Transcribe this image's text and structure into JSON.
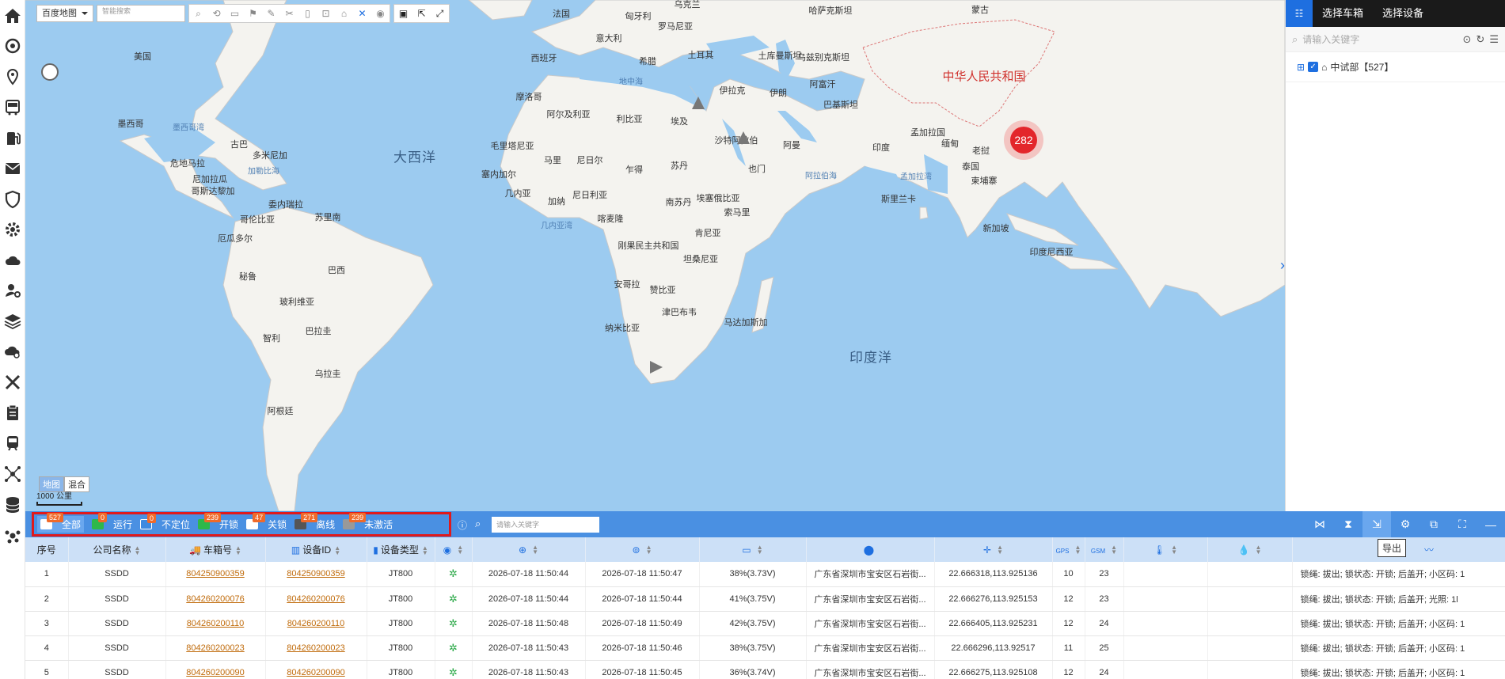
{
  "map_toolbar": {
    "map_type_select": "百度地图",
    "search_placeholder": "智能搜索",
    "icons": [
      "search-area-icon",
      "route-icon",
      "rectangle-icon",
      "flag-icon",
      "brush-icon",
      "clear-icon",
      "ruler-icon",
      "camera-icon",
      "chart-icon",
      "crosshair-icon",
      "location-icon",
      "save-icon",
      "export-icon",
      "fullscreen-icon"
    ]
  },
  "map": {
    "labels": [
      {
        "text": "法国",
        "cls": ""
      },
      {
        "text": "乌克兰",
        "cls": ""
      },
      {
        "text": "哈萨克斯坦",
        "cls": ""
      },
      {
        "text": "蒙古",
        "cls": ""
      },
      {
        "text": "匈牙利",
        "cls": ""
      },
      {
        "text": "罗马尼亚",
        "cls": ""
      },
      {
        "text": "意大利",
        "cls": ""
      },
      {
        "text": "美国",
        "cls": ""
      },
      {
        "text": "西班牙",
        "cls": ""
      },
      {
        "text": "希腊",
        "cls": ""
      },
      {
        "text": "土耳其",
        "cls": ""
      },
      {
        "text": "土库曼斯坦",
        "cls": ""
      },
      {
        "text": "乌兹别克斯坦",
        "cls": ""
      },
      {
        "text": "中华人民共和国",
        "cls": "china"
      },
      {
        "text": "地中海",
        "cls": "sea"
      },
      {
        "text": "摩洛哥",
        "cls": ""
      },
      {
        "text": "阿尔及利亚",
        "cls": ""
      },
      {
        "text": "利比亚",
        "cls": ""
      },
      {
        "text": "埃及",
        "cls": ""
      },
      {
        "text": "伊拉克",
        "cls": ""
      },
      {
        "text": "伊朗",
        "cls": ""
      },
      {
        "text": "阿富汗",
        "cls": ""
      },
      {
        "text": "巴基斯坦",
        "cls": ""
      },
      {
        "text": "墨西哥",
        "cls": ""
      },
      {
        "text": "墨西哥湾",
        "cls": "sea"
      },
      {
        "text": "古巴",
        "cls": ""
      },
      {
        "text": "多米尼加",
        "cls": ""
      },
      {
        "text": "危地马拉",
        "cls": ""
      },
      {
        "text": "尼加拉瓜",
        "cls": ""
      },
      {
        "text": "哥斯达黎加",
        "cls": ""
      },
      {
        "text": "加勒比海",
        "cls": "sea"
      },
      {
        "text": "大西洋",
        "cls": "ocean"
      },
      {
        "text": "毛里塔尼亚",
        "cls": ""
      },
      {
        "text": "马里",
        "cls": ""
      },
      {
        "text": "尼日尔",
        "cls": ""
      },
      {
        "text": "乍得",
        "cls": ""
      },
      {
        "text": "苏丹",
        "cls": ""
      },
      {
        "text": "沙特阿拉伯",
        "cls": ""
      },
      {
        "text": "阿曼",
        "cls": ""
      },
      {
        "text": "也门",
        "cls": ""
      },
      {
        "text": "印度",
        "cls": ""
      },
      {
        "text": "孟加拉国",
        "cls": ""
      },
      {
        "text": "缅甸",
        "cls": ""
      },
      {
        "text": "老挝",
        "cls": ""
      },
      {
        "text": "泰国",
        "cls": ""
      },
      {
        "text": "柬埔寨",
        "cls": ""
      },
      {
        "text": "阿拉伯海",
        "cls": "sea"
      },
      {
        "text": "孟加拉湾",
        "cls": "sea"
      },
      {
        "text": "塞内加尔",
        "cls": ""
      },
      {
        "text": "几内亚",
        "cls": ""
      },
      {
        "text": "尼日利亚",
        "cls": ""
      },
      {
        "text": "埃塞俄比亚",
        "cls": ""
      },
      {
        "text": "委内瑞拉",
        "cls": ""
      },
      {
        "text": "苏里南",
        "cls": ""
      },
      {
        "text": "哥伦比亚",
        "cls": ""
      },
      {
        "text": "厄瓜多尔",
        "cls": ""
      },
      {
        "text": "加纳",
        "cls": ""
      },
      {
        "text": "喀麦隆",
        "cls": ""
      },
      {
        "text": "南苏丹",
        "cls": ""
      },
      {
        "text": "索马里",
        "cls": ""
      },
      {
        "text": "斯里兰卡",
        "cls": ""
      },
      {
        "text": "几内亚湾",
        "cls": "sea"
      },
      {
        "text": "新加坡",
        "cls": ""
      },
      {
        "text": "刚果民主共和国",
        "cls": ""
      },
      {
        "text": "肯尼亚",
        "cls": ""
      },
      {
        "text": "坦桑尼亚",
        "cls": ""
      },
      {
        "text": "印度尼西亚",
        "cls": ""
      },
      {
        "text": "巴西",
        "cls": ""
      },
      {
        "text": "秘鲁",
        "cls": ""
      },
      {
        "text": "安哥拉",
        "cls": ""
      },
      {
        "text": "赞比亚",
        "cls": ""
      },
      {
        "text": "玻利维亚",
        "cls": ""
      },
      {
        "text": "津巴布韦",
        "cls": ""
      },
      {
        "text": "马达加斯加",
        "cls": ""
      },
      {
        "text": "巴拉圭",
        "cls": ""
      },
      {
        "text": "纳米比亚",
        "cls": ""
      },
      {
        "text": "智利",
        "cls": ""
      },
      {
        "text": "印度洋",
        "cls": "ocean"
      },
      {
        "text": "乌拉圭",
        "cls": ""
      },
      {
        "text": "阿根廷",
        "cls": ""
      }
    ],
    "cluster_count": "282",
    "map_type_buttons": [
      "地图",
      "混合"
    ],
    "scale_label": "1000 公里"
  },
  "right_panel": {
    "tabs": [
      "选择车箱",
      "选择设备"
    ],
    "search_placeholder": "请输入关键字",
    "tree_root": "中试部【527】"
  },
  "status_bar": {
    "filters": [
      {
        "label": "全部",
        "count": "527",
        "color": "#ffffff"
      },
      {
        "label": "运行",
        "count": "0",
        "color": "#2eb84a"
      },
      {
        "label": "不定位",
        "count": "0",
        "color": "#3d8ae0"
      },
      {
        "label": "开锁",
        "count": "239",
        "color": "#2eb84a"
      },
      {
        "label": "关锁",
        "count": "47",
        "color": "#ffffff"
      },
      {
        "label": "离线",
        "count": "271",
        "color": "#555555"
      },
      {
        "label": "未激活",
        "count": "239",
        "color": "#999999"
      }
    ],
    "search_placeholder": "请输入关键字",
    "export_tooltip": "导出"
  },
  "table": {
    "headers": [
      "序号",
      "公司名称",
      "车箱号",
      "设备ID",
      "设备类型",
      "",
      "",
      "",
      "",
      "",
      "",
      "",
      "",
      "",
      "",
      ""
    ],
    "rows": [
      [
        "1",
        "SSDD",
        "804250900359",
        "804250900359",
        "JT800",
        "2026-07-18 11:50:44",
        "2026-07-18 11:50:47",
        "38%(3.73V)",
        "广东省深圳市宝安区石岩街...",
        "22.666318,113.925136",
        "10",
        "23",
        "锁绳: 拔出; 锁状态: 开锁; 后盖开; 小区码: 1"
      ],
      [
        "2",
        "SSDD",
        "804260200076",
        "804260200076",
        "JT800",
        "2026-07-18 11:50:44",
        "2026-07-18 11:50:44",
        "41%(3.75V)",
        "广东省深圳市宝安区石岩街...",
        "22.666276,113.925153",
        "12",
        "23",
        "锁绳: 拔出; 锁状态: 开锁; 后盖开; 光照: 1l"
      ],
      [
        "3",
        "SSDD",
        "804260200110",
        "804260200110",
        "JT800",
        "2026-07-18 11:50:48",
        "2026-07-18 11:50:49",
        "42%(3.75V)",
        "广东省深圳市宝安区石岩街...",
        "22.666405,113.925231",
        "12",
        "24",
        "锁绳: 拔出; 锁状态: 开锁; 后盖开; 小区码: 1"
      ],
      [
        "4",
        "SSDD",
        "804260200023",
        "804260200023",
        "JT800",
        "2026-07-18 11:50:43",
        "2026-07-18 11:50:46",
        "38%(3.75V)",
        "广东省深圳市宝安区石岩街...",
        "22.666296,113.92517",
        "11",
        "25",
        "锁绳: 拔出; 锁状态: 开锁; 后盖开; 小区码: 1"
      ],
      [
        "5",
        "SSDD",
        "804260200090",
        "804260200090",
        "JT800",
        "2026-07-18 11:50:43",
        "2026-07-18 11:50:45",
        "36%(3.74V)",
        "广东省深圳市宝安区石岩街...",
        "22.666275,113.925108",
        "12",
        "24",
        "锁绳: 拔出; 锁状态: 开锁; 后盖开; 小区码: 1"
      ]
    ],
    "icon_headers": [
      "gps-icon",
      "gsm-icon"
    ]
  }
}
